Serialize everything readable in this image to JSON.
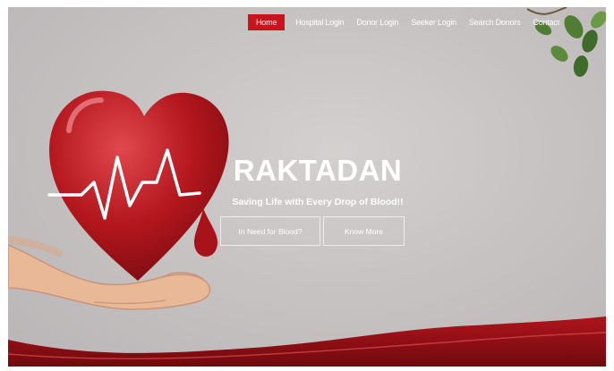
{
  "nav": {
    "items": [
      {
        "label": "Home",
        "active": true
      },
      {
        "label": "Hospital Login"
      },
      {
        "label": "Donor Login"
      },
      {
        "label": "Seeker Login"
      },
      {
        "label": "Search Donors"
      },
      {
        "label": "Contact"
      }
    ],
    "active_color": "#c8141c"
  },
  "hero": {
    "title": "RAKTADAN",
    "subtitle": "Saving Life with Every Drop of Blood!!",
    "buttons": {
      "need_blood": "In Need for Blood?",
      "know_more": "Know More"
    }
  },
  "theme": {
    "accent": "#c8141c",
    "heart": "#b3161d",
    "leaf": "#3f6b2a"
  }
}
